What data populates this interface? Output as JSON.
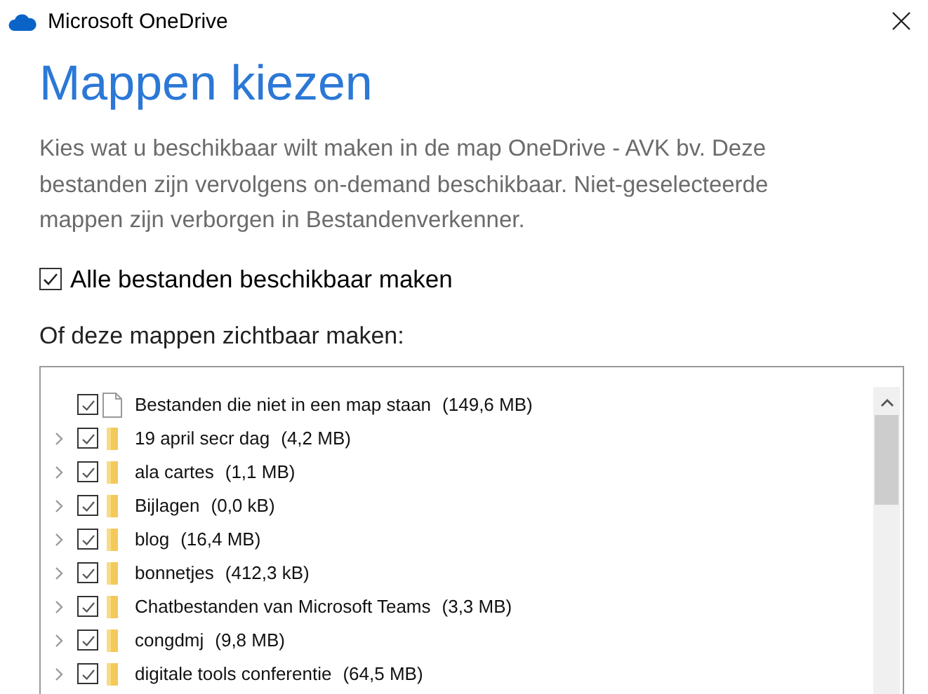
{
  "window": {
    "title": "Microsoft OneDrive"
  },
  "heading": "Mappen kiezen",
  "description": "Kies wat u beschikbaar wilt maken in de map OneDrive - AVK bv. Deze bestanden zijn vervolgens on-demand beschikbaar. Niet-geselecteerde mappen zijn verborgen in Bestandenverkenner.",
  "select_all": {
    "label": "Alle bestanden beschikbaar maken",
    "checked": true
  },
  "list_label": "Of deze mappen zichtbaar maken:",
  "items": [
    {
      "kind": "file",
      "label": "Bestanden die niet in een map staan",
      "size": "(149,6 MB)",
      "checked": true
    },
    {
      "kind": "folder",
      "label": "19 april secr dag",
      "size": "(4,2 MB)",
      "checked": true
    },
    {
      "kind": "folder",
      "label": "ala cartes",
      "size": "(1,1 MB)",
      "checked": true
    },
    {
      "kind": "folder",
      "label": "Bijlagen",
      "size": "(0,0 kB)",
      "checked": true
    },
    {
      "kind": "folder",
      "label": "blog",
      "size": "(16,4 MB)",
      "checked": true
    },
    {
      "kind": "folder",
      "label": "bonnetjes",
      "size": "(412,3 kB)",
      "checked": true
    },
    {
      "kind": "folder",
      "label": "Chatbestanden van Microsoft Teams",
      "size": "(3,3 MB)",
      "checked": true
    },
    {
      "kind": "folder",
      "label": "congdmj",
      "size": "(9,8 MB)",
      "checked": true
    },
    {
      "kind": "folder",
      "label": "digitale tools conferentie",
      "size": "(64,5 MB)",
      "checked": true
    }
  ]
}
